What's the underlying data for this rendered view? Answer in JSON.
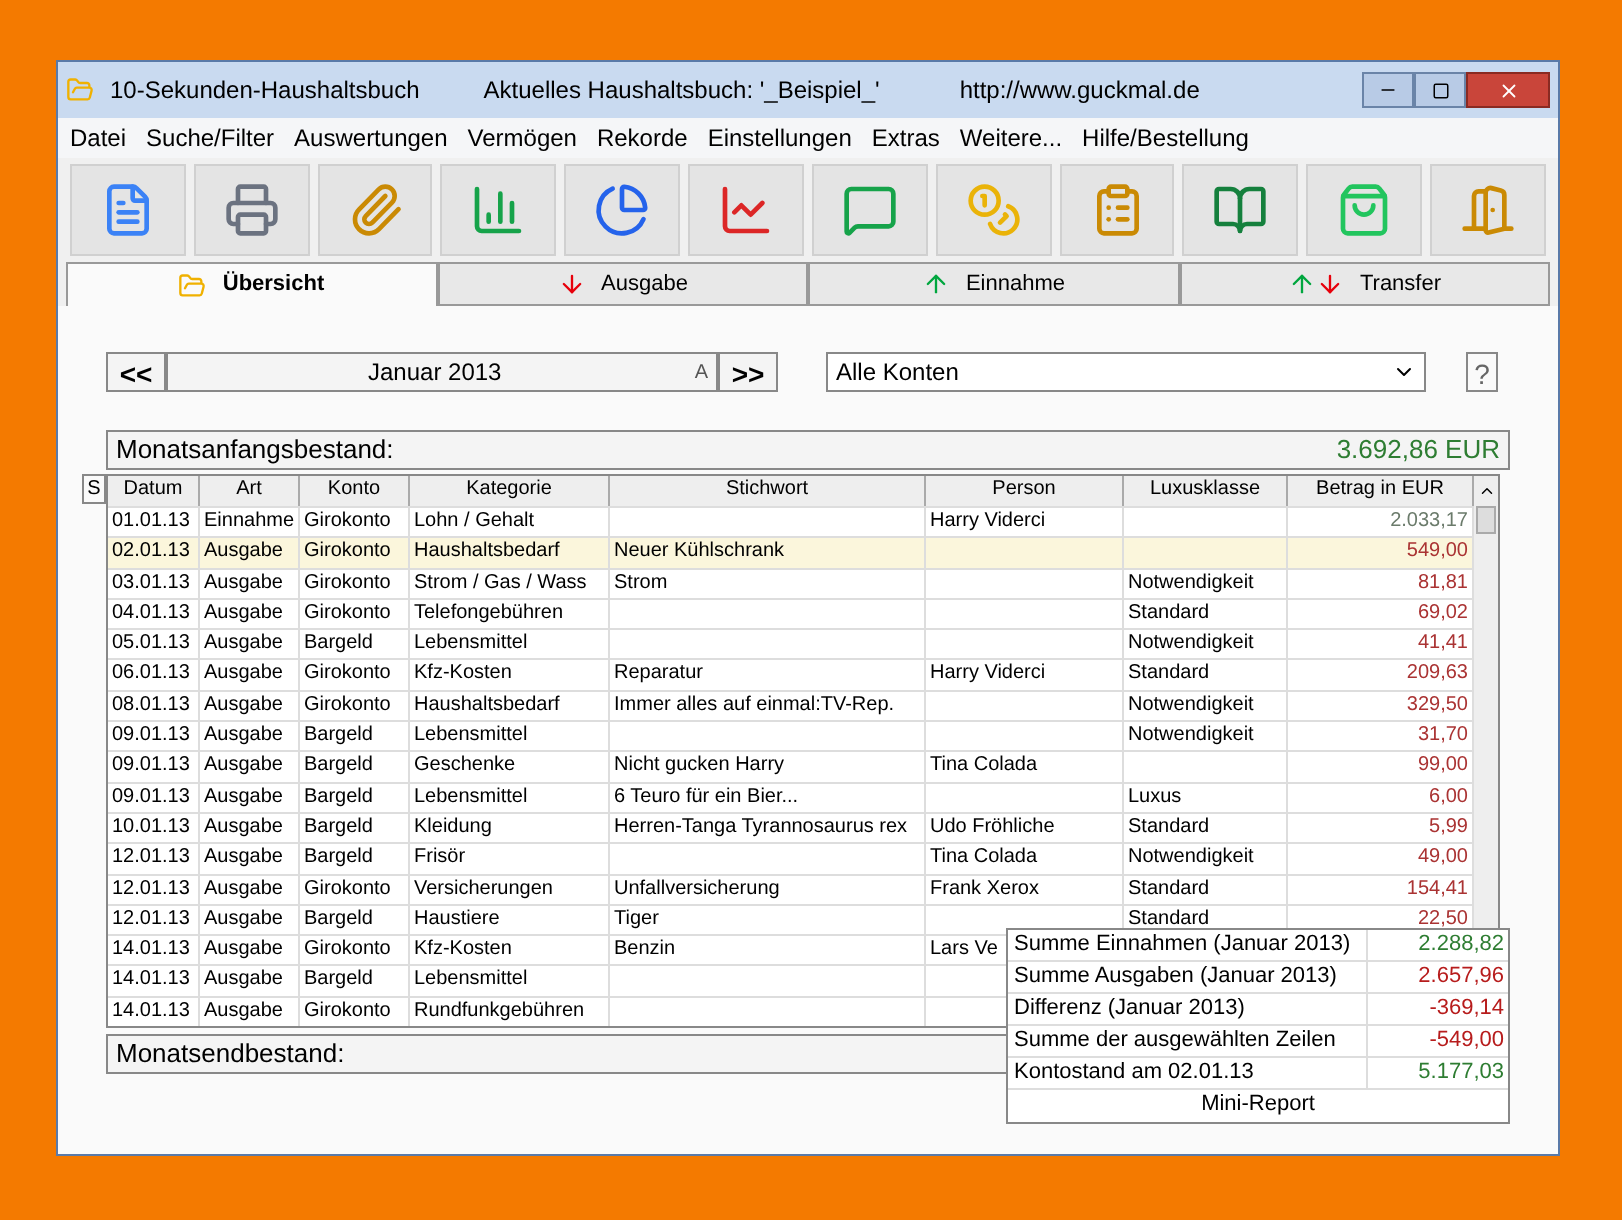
{
  "window": {
    "title": "10-Sekunden-Haushaltsbuch",
    "book": "Aktuelles Haushaltsbuch: '_Beispiel_'",
    "url": "http://www.guckmal.de"
  },
  "menu": [
    "Datei",
    "Suche/Filter",
    "Auswertungen",
    "Vermögen",
    "Rekorde",
    "Einstellungen",
    "Extras",
    "Weitere...",
    "Hilfe/Bestellung"
  ],
  "tabs": [
    {
      "label": "Übersicht",
      "kind": "overview",
      "selected": true
    },
    {
      "label": "Ausgabe",
      "kind": "down",
      "selected": false
    },
    {
      "label": "Einnahme",
      "kind": "up",
      "selected": false
    },
    {
      "label": "Transfer",
      "kind": "both",
      "selected": false
    }
  ],
  "nav": {
    "prev": "<<",
    "month": "Januar 2013",
    "marker": "A",
    "next": ">>",
    "account": "Alle Konten",
    "help": "?"
  },
  "opening": {
    "label": "Monatsanfangsbestand:",
    "value": "3.692,86 EUR"
  },
  "table": {
    "corner": "S",
    "columns": [
      "Datum",
      "Art",
      "Konto",
      "Kategorie",
      "Stichwort",
      "Person",
      "Luxusklasse",
      "Betrag in EUR"
    ],
    "rows": [
      {
        "kind": "income",
        "selected": false,
        "cells": [
          "01.01.13",
          "Einnahme",
          "Girokonto",
          "Lohn / Gehalt",
          "",
          "Harry Viderci",
          "",
          "2.033,17"
        ]
      },
      {
        "kind": "expense",
        "selected": true,
        "cells": [
          "02.01.13",
          "Ausgabe",
          "Girokonto",
          "Haushaltsbedarf",
          "Neuer Kühlschrank",
          "",
          "",
          "549,00"
        ]
      },
      {
        "kind": "expense",
        "selected": false,
        "cells": [
          "03.01.13",
          "Ausgabe",
          "Girokonto",
          "Strom / Gas / Wass",
          "Strom",
          "",
          "Notwendigkeit",
          "81,81"
        ]
      },
      {
        "kind": "expense",
        "selected": false,
        "cells": [
          "04.01.13",
          "Ausgabe",
          "Girokonto",
          "Telefongebühren",
          "",
          "",
          "Standard",
          "69,02"
        ]
      },
      {
        "kind": "expense",
        "selected": false,
        "cells": [
          "05.01.13",
          "Ausgabe",
          "Bargeld",
          "Lebensmittel",
          "",
          "",
          "Notwendigkeit",
          "41,41"
        ]
      },
      {
        "kind": "expense",
        "selected": false,
        "cells": [
          "06.01.13",
          "Ausgabe",
          "Girokonto",
          "Kfz-Kosten",
          "Reparatur",
          "Harry Viderci",
          "Standard",
          "209,63"
        ]
      },
      {
        "kind": "expense",
        "selected": false,
        "cells": [
          "08.01.13",
          "Ausgabe",
          "Girokonto",
          "Haushaltsbedarf",
          "Immer alles auf einmal:TV-Rep.",
          "",
          "Notwendigkeit",
          "329,50"
        ]
      },
      {
        "kind": "expense",
        "selected": false,
        "cells": [
          "09.01.13",
          "Ausgabe",
          "Bargeld",
          "Lebensmittel",
          "",
          "",
          "Notwendigkeit",
          "31,70"
        ]
      },
      {
        "kind": "expense",
        "selected": false,
        "cells": [
          "09.01.13",
          "Ausgabe",
          "Bargeld",
          "Geschenke",
          "Nicht gucken Harry",
          "Tina Colada",
          "",
          "99,00"
        ]
      },
      {
        "kind": "expense",
        "selected": false,
        "cells": [
          "09.01.13",
          "Ausgabe",
          "Bargeld",
          "Lebensmittel",
          "6 Teuro für ein Bier...",
          "",
          "Luxus",
          "6,00"
        ]
      },
      {
        "kind": "expense",
        "selected": false,
        "cells": [
          "10.01.13",
          "Ausgabe",
          "Bargeld",
          "Kleidung",
          "Herren-Tanga Tyrannosaurus rex",
          "Udo Fröhliche",
          "Standard",
          "5,99"
        ]
      },
      {
        "kind": "expense",
        "selected": false,
        "cells": [
          "12.01.13",
          "Ausgabe",
          "Bargeld",
          "Frisör",
          "",
          "Tina Colada",
          "Notwendigkeit",
          "49,00"
        ]
      },
      {
        "kind": "expense",
        "selected": false,
        "cells": [
          "12.01.13",
          "Ausgabe",
          "Girokonto",
          "Versicherungen",
          "Unfallversicherung",
          "Frank Xerox",
          "Standard",
          "154,41"
        ]
      },
      {
        "kind": "expense",
        "selected": false,
        "cells": [
          "12.01.13",
          "Ausgabe",
          "Bargeld",
          "Haustiere",
          "Tiger",
          "",
          "Standard",
          "22,50"
        ]
      },
      {
        "kind": "expense",
        "selected": false,
        "cells": [
          "14.01.13",
          "Ausgabe",
          "Girokonto",
          "Kfz-Kosten",
          "Benzin",
          "Lars Ve",
          "",
          ""
        ]
      },
      {
        "kind": "expense",
        "selected": false,
        "cells": [
          "14.01.13",
          "Ausgabe",
          "Bargeld",
          "Lebensmittel",
          "",
          "",
          "",
          ""
        ]
      },
      {
        "kind": "expense",
        "selected": false,
        "cells": [
          "14.01.13",
          "Ausgabe",
          "Girokonto",
          "Rundfunkgebühren",
          "",
          "",
          "",
          ""
        ]
      }
    ]
  },
  "closing": {
    "label": "Monatsendbestand:"
  },
  "mini_report": {
    "title": "Mini-Report",
    "items": [
      {
        "label": "Summe Einnahmen (Januar 2013)",
        "value": "2.288,82",
        "color": "#2e7d32"
      },
      {
        "label": "Summe Ausgaben (Januar 2013)",
        "value": "2.657,96",
        "color": "#b71c1c"
      },
      {
        "label": "Differenz (Januar 2013)",
        "value": "-369,14",
        "color": "#b71c1c"
      },
      {
        "label": "Summe der ausgewählten Zeilen",
        "value": "-549,00",
        "color": "#b71c1c"
      },
      {
        "label": "Kontostand am 02.01.13",
        "value": "5.177,03",
        "color": "#2e7d32"
      }
    ]
  }
}
